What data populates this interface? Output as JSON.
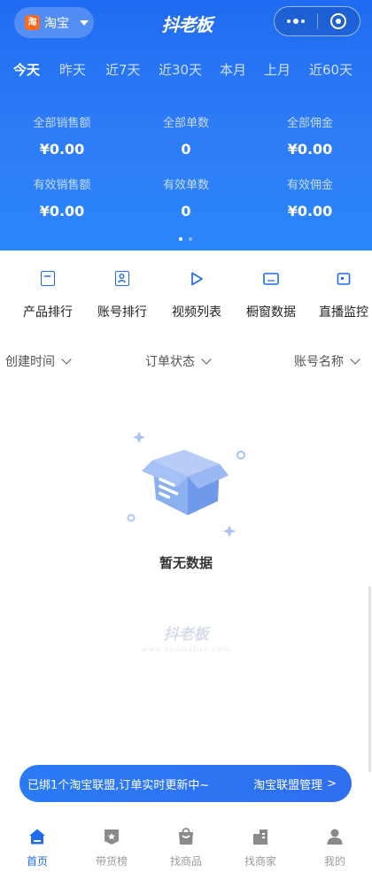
{
  "topbar": {
    "platform_badge": "淘",
    "platform_name": "淘宝",
    "logo": "抖老板"
  },
  "tabs": [
    "今天",
    "昨天",
    "近7天",
    "近30天",
    "本月",
    "上月",
    "近60天"
  ],
  "active_tab": "今天",
  "stats": [
    {
      "label": "全部销售额",
      "value": "¥0.00"
    },
    {
      "label": "全部单数",
      "value": "0"
    },
    {
      "label": "全部佣金",
      "value": "¥0.00"
    },
    {
      "label": "有效销售额",
      "value": "¥0.00"
    },
    {
      "label": "有效单数",
      "value": "0"
    },
    {
      "label": "有效佣金",
      "value": "¥0.00"
    }
  ],
  "functions": [
    {
      "label": "产品排行",
      "icon": "bag-icon"
    },
    {
      "label": "账号排行",
      "icon": "portrait-icon"
    },
    {
      "label": "视频列表",
      "icon": "play-icon"
    },
    {
      "label": "橱窗数据",
      "icon": "window-icon"
    },
    {
      "label": "直播监控",
      "icon": "monitor-icon"
    }
  ],
  "filters": [
    {
      "label": "创建时间"
    },
    {
      "label": "订单状态"
    },
    {
      "label": "账号名称"
    }
  ],
  "empty": {
    "text": "暂无数据"
  },
  "watermark": {
    "logo": "抖老板",
    "url": "www.doulaoban.com"
  },
  "banner": {
    "message": "已绑1个淘宝联盟,订单实时更新中~",
    "action": "淘宝联盟管理",
    "arrow": ">"
  },
  "tabbar": [
    {
      "label": "首页",
      "icon": "home-icon",
      "active": true
    },
    {
      "label": "带货榜",
      "icon": "ranking-icon",
      "active": false
    },
    {
      "label": "找商品",
      "icon": "shopping-bag-icon",
      "active": false
    },
    {
      "label": "找商家",
      "icon": "building-icon",
      "active": false
    },
    {
      "label": "我的",
      "icon": "user-icon",
      "active": false
    }
  ],
  "colors": {
    "primary": "#1f6cf2",
    "taobao": "#ff6a18",
    "inactive_tab": "#9a9a9a"
  }
}
